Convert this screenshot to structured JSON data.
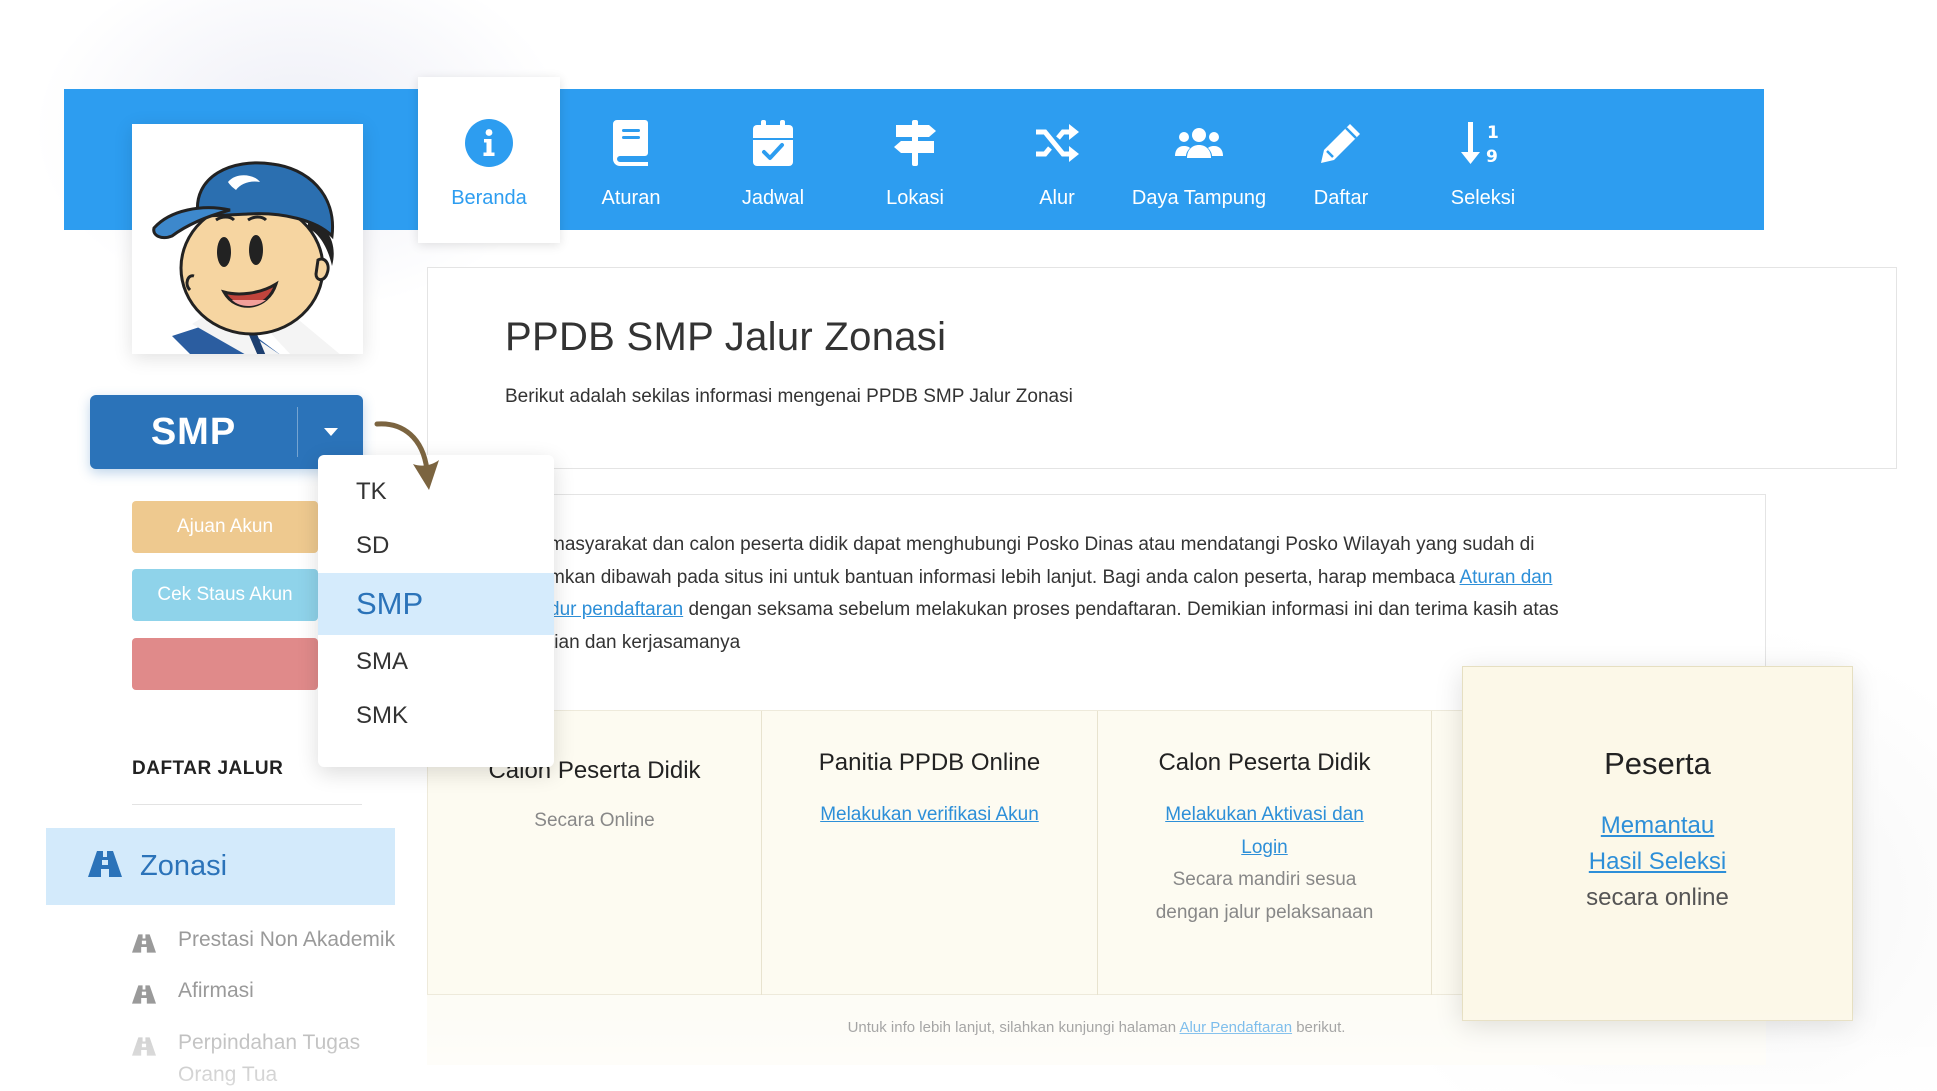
{
  "nav": {
    "items": [
      {
        "label": "Beranda",
        "icon": "info-circle-icon",
        "active": true
      },
      {
        "label": "Aturan",
        "icon": "book-icon"
      },
      {
        "label": "Jadwal",
        "icon": "calendar-check-icon"
      },
      {
        "label": "Lokasi",
        "icon": "signpost-icon"
      },
      {
        "label": "Alur",
        "icon": "shuffle-icon"
      },
      {
        "label": "Daya Tampung",
        "icon": "users-icon"
      },
      {
        "label": "Daftar",
        "icon": "pencil-icon"
      },
      {
        "label": "Seleksi",
        "icon": "sort-numeric-icon"
      }
    ]
  },
  "sidebar": {
    "level_selected": "SMP",
    "buttons": [
      {
        "label": "Ajuan Akun",
        "color": "#eec98f"
      },
      {
        "label": "Cek Staus Akun",
        "color": "#8fd3ea"
      },
      {
        "label": "",
        "color": "#e08a8a"
      }
    ],
    "level_options": [
      "TK",
      "SD",
      "SMP",
      "SMA",
      "SMK"
    ],
    "daftar_jalur_title": "DAFTAR JALUR",
    "jalur": {
      "active": "Zonasi",
      "others": [
        "Prestasi Non Akademik",
        "Afirmasi",
        "Perpindahan Tugas Orang Tua"
      ]
    }
  },
  "main": {
    "title": "PPDB SMP Jalur Zonasi",
    "subtitle": "Berikut adalah sekilas informasi mengenai PPDB SMP Jalur Zonasi",
    "info": {
      "part1": "masyarakat dan calon peserta didik dapat menghubungi Posko Dinas atau mendatangi Posko Wilayah yang sudah di",
      "part2": "mkan dibawah pada situs ini untuk bantuan informasi lebih lanjut. Bagi anda calon peserta, harap membaca",
      "link1": "Aturan dan",
      "link2": "dur pendaftaran",
      "part3": "dengan seksama sebelum melakukan proses pendaftaran. Demikian informasi ini dan terima kasih atas",
      "part4": "tian dan kerjasamanya"
    },
    "steps": [
      {
        "title": "Calon Peserta Didik",
        "text": "Secara Online"
      },
      {
        "title": "Panitia PPDB Online",
        "link": "Melakukan verifikasi Akun"
      },
      {
        "title": "Calon Peserta Didik",
        "link": "Melakukan Aktivasi dan Login",
        "text": "Secara mandiri sesua dengan jalur pelaksanaan"
      }
    ],
    "peserta": {
      "title": "Peserta",
      "link1": "Memantau",
      "link2": "Hasil Seleksi",
      "text": "secara online"
    },
    "footer": {
      "prefix": "Untuk info lebih lanjut, silahkan kunjungi halaman",
      "link": "Alur Pendaftaran",
      "suffix": "berikut."
    }
  },
  "colors": {
    "nav_blue": "#2d9df0",
    "level_blue": "#2b73b9",
    "card_cream": "#fcf8e8"
  }
}
